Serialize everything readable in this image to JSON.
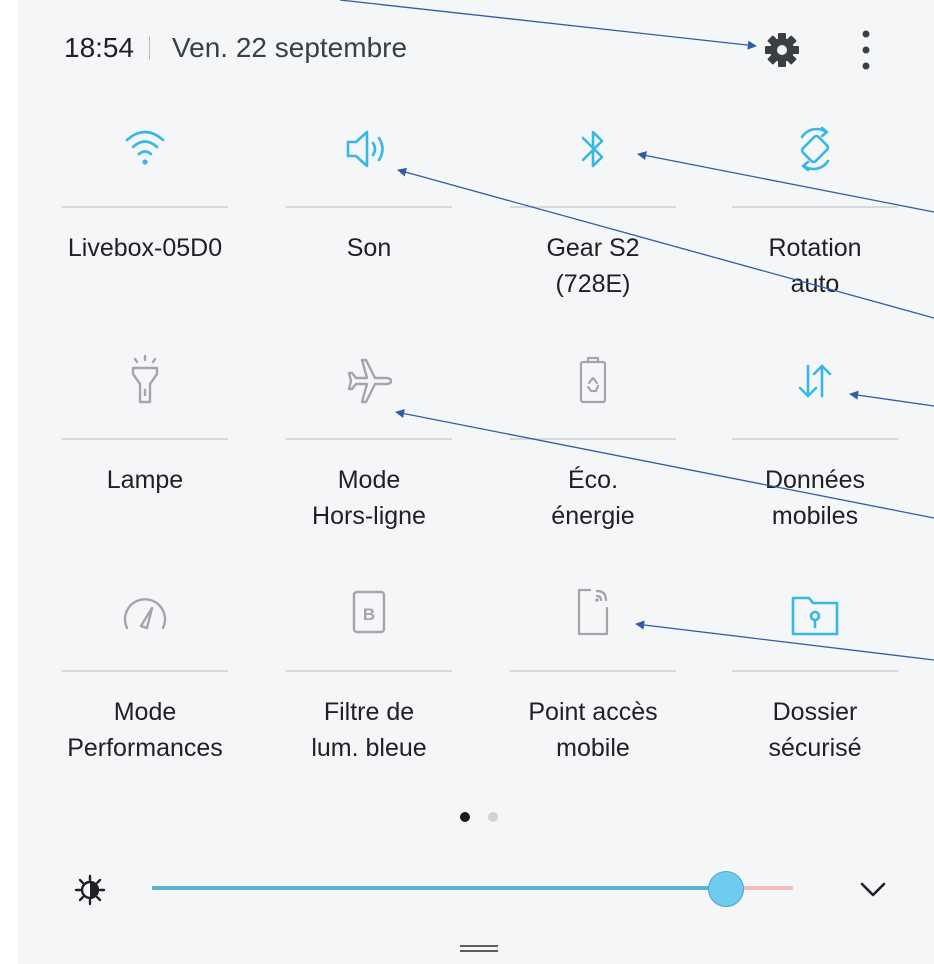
{
  "status_bar": {
    "time": "18:54",
    "date": "Ven. 22 septembre"
  },
  "header_icons": [
    "gear-icon",
    "more-vertical-icon"
  ],
  "colors": {
    "accent": "#35b8e8",
    "inactive_icon": "#a3a5a8",
    "annotation": "#2f5ea6",
    "slider_thumb": "#70cbf1"
  },
  "tiles": [
    {
      "label": "Livebox-05D0",
      "icon": "wifi-icon",
      "active": true
    },
    {
      "label": "Son",
      "icon": "sound-icon",
      "active": true
    },
    {
      "label": "Gear S2\n(728E)",
      "icon": "bluetooth-icon",
      "active": true
    },
    {
      "label": "Rotation\nauto",
      "icon": "auto-rotate-icon",
      "active": true
    },
    {
      "label": "Lampe",
      "icon": "flashlight-icon",
      "active": false
    },
    {
      "label": "Mode\nHors-ligne",
      "icon": "airplane-icon",
      "active": false
    },
    {
      "label": "Éco.\nénergie",
      "icon": "battery-saver-icon",
      "active": false
    },
    {
      "label": "Données\nmobiles",
      "icon": "mobile-data-icon",
      "active": true
    },
    {
      "label": "Mode\nPerformances",
      "icon": "speedometer-icon",
      "active": false
    },
    {
      "label": "Filtre de\nlum. bleue",
      "icon": "blue-light-filter-icon",
      "active": false
    },
    {
      "label": "Point accès\nmobile",
      "icon": "mobile-hotspot-icon",
      "active": false
    },
    {
      "label": "Dossier\nsécurisé",
      "icon": "secure-folder-icon",
      "active": true
    }
  ],
  "pager": {
    "page": 1,
    "pages": 2
  },
  "brightness": {
    "level": 0.89,
    "icon": "brightness-icon",
    "expand_icon": "chevron-down-icon"
  }
}
